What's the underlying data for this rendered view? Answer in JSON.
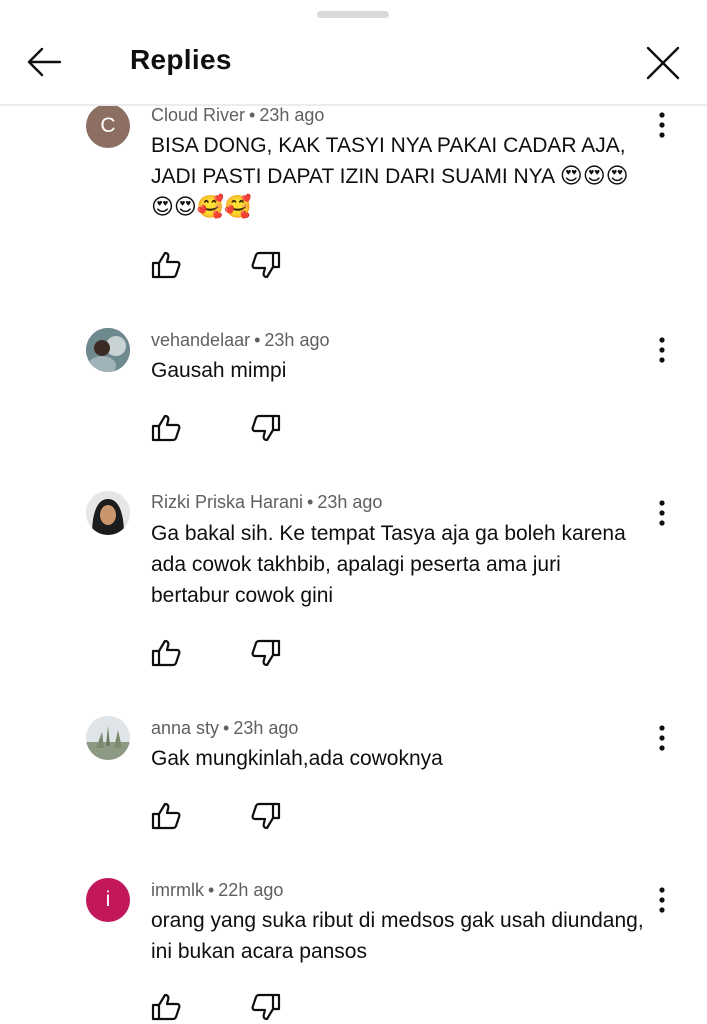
{
  "header": {
    "title": "Replies"
  },
  "comments": [
    {
      "author": "Cloud River",
      "time": "23h ago",
      "avatar_letter": "C",
      "avatar_color": "#8d6e63",
      "text_line1": "BISA DONG, KAK TASYI NYA PAKAI CADAR AJA,",
      "text_line2": "JADI PASTI DAPAT IZIN DARI SUAMI NYA ",
      "emoji_line2": "😍😍😍",
      "emoji_line3": "😍😍🥰🥰"
    },
    {
      "author": "vehandelaar",
      "time": "23h ago",
      "text": "Gausah mimpi"
    },
    {
      "author": "Rizki Priska Harani",
      "time": "23h ago",
      "text": "Ga bakal sih. Ke tempat Tasya aja ga boleh karena ada cowok takhbib, apalagi peserta ama juri bertabur cowok gini"
    },
    {
      "author": "anna sty",
      "time": "23h ago",
      "text": "Gak mungkinlah,ada cowoknya"
    },
    {
      "author": "imrmlk",
      "time": "22h ago",
      "avatar_letter": "i",
      "avatar_color": "#c2185b",
      "text": "orang yang suka ribut di medsos gak usah diundang, ini bukan acara pansos"
    }
  ]
}
